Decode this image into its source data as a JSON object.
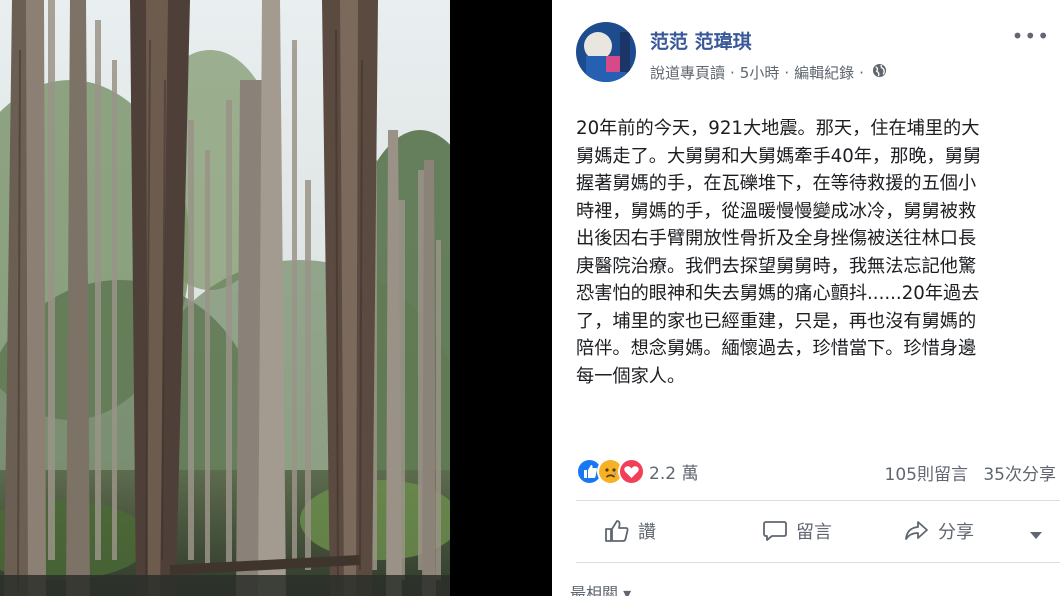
{
  "post": {
    "author": "范范 范瑋琪",
    "meta_via": "說道專頁讀",
    "meta_time": "5小時",
    "meta_edit": "編輯紀錄",
    "more_label": "•••",
    "text": "20年前的今天，921大地震。那天，住在埔里的大\n舅媽走了。大舅舅和大舅媽牽手40年，那晚，舅舅\n握著舅媽的手，在瓦礫堆下，在等待救援的五個小\n時裡，舅媽的手，從溫暖慢慢變成冰冷，舅舅被救\n出後因右手臂開放性骨折及全身挫傷被送往林口長\n庚醫院治療。我們去探望舅舅時，我無法忘記他驚\n恐害怕的眼神和失去舅媽的痛心顫抖......20年過去\n了，埔里的家也已經重建，只是，再也沒有舅媽的\n陪伴。想念舅媽。緬懷過去，珍惜當下。珍惜身邊\n每一個家人。"
  },
  "reactions": {
    "count": "2.2 萬",
    "icons": [
      "like-reaction-icon",
      "sad-reaction-icon",
      "love-reaction-icon"
    ],
    "colors": {
      "like": "#1877f2",
      "sad": "#f7b125",
      "love": "#f33e58"
    }
  },
  "stats": {
    "comments": "105則留言",
    "shares": "35次分享"
  },
  "actions": {
    "like": "讚",
    "comment": "留言",
    "share": "分享"
  },
  "related": "最相關 ▾",
  "colors": {
    "author": "#385898",
    "muted": "#606770",
    "text": "#1c1e21"
  }
}
